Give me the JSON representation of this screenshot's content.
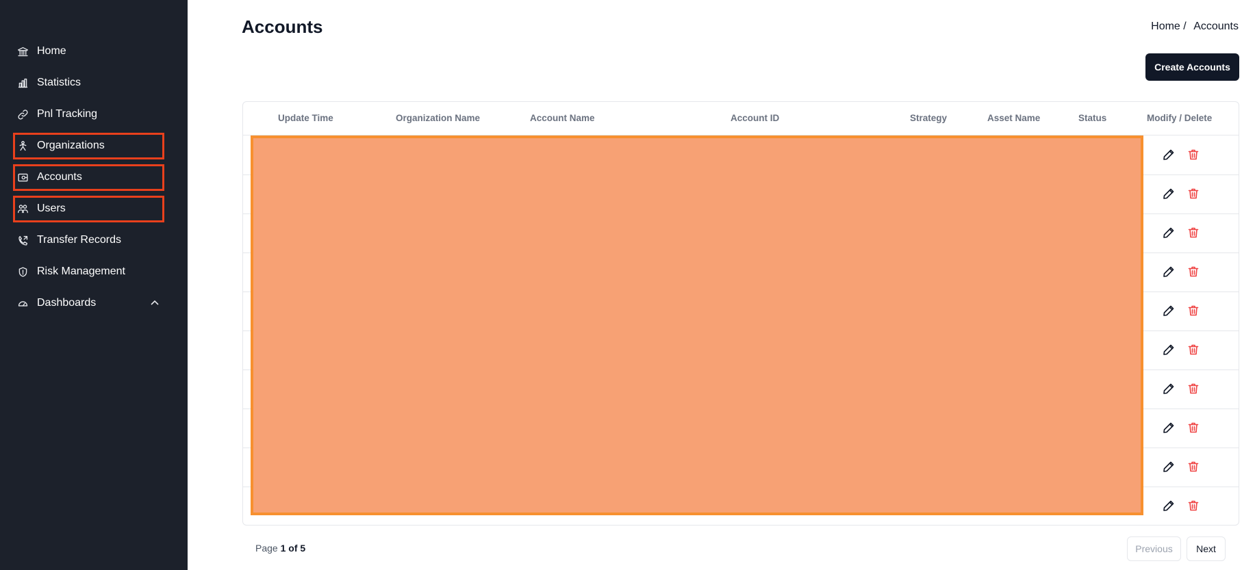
{
  "sidebar": {
    "items": [
      {
        "label": "Home",
        "icon": "bank-icon"
      },
      {
        "label": "Statistics",
        "icon": "bar-chart-icon"
      },
      {
        "label": "Pnl Tracking",
        "icon": "link-icon"
      },
      {
        "label": "Organizations",
        "icon": "organizations-icon"
      },
      {
        "label": "Accounts",
        "icon": "wallet-icon"
      },
      {
        "label": "Users",
        "icon": "users-icon"
      },
      {
        "label": "Transfer Records",
        "icon": "phone-transfer-icon"
      },
      {
        "label": "Risk Management",
        "icon": "shield-icon"
      },
      {
        "label": "Dashboards",
        "icon": "gauge-icon"
      }
    ]
  },
  "header": {
    "title": "Accounts",
    "breadcrumb": [
      "Home",
      "Accounts"
    ],
    "breadcrumb_sep": "/",
    "create_button": "Create Accounts"
  },
  "table": {
    "columns": [
      "Update Time",
      "Organization Name",
      "Account Name",
      "Account ID",
      "Strategy",
      "Asset Name",
      "Status",
      "Modify / Delete"
    ],
    "row_count": 10,
    "redacted": true
  },
  "pagination": {
    "page_label": "Page",
    "current_of_total": "1 of 5",
    "previous": "Previous",
    "next": "Next"
  },
  "colors": {
    "sidebar_bg": "#1c212b",
    "highlight_border": "#e8401c",
    "redaction_fill": "#f7a174",
    "redaction_border": "#f7902f",
    "delete_icon": "#ef4444",
    "primary_button": "#111827"
  }
}
